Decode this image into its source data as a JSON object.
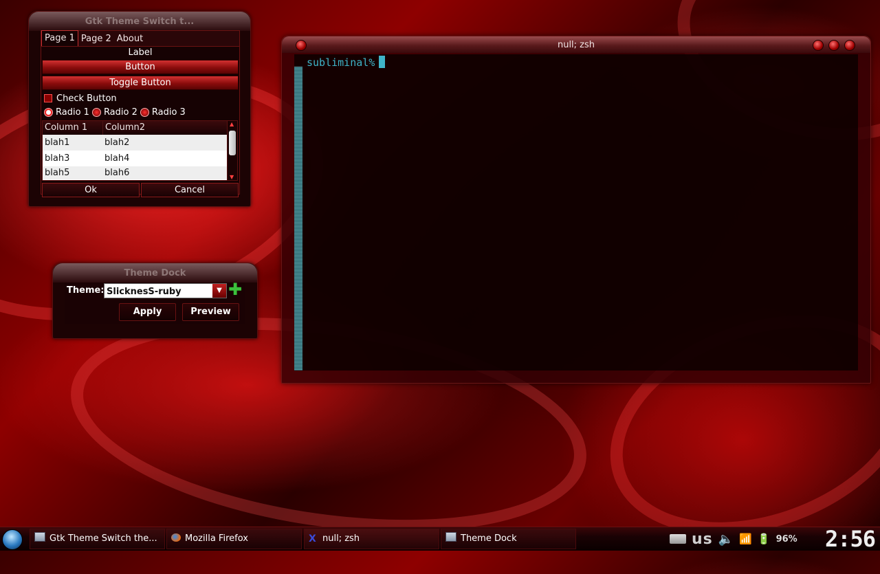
{
  "gtk_window": {
    "title": "Gtk Theme Switch t...",
    "tabs": [
      "Page 1",
      "Page 2",
      "About"
    ],
    "label": "Label",
    "button": "Button",
    "toggle_button": "Toggle Button",
    "check_button": "Check Button",
    "radios": [
      "Radio 1",
      "Radio 2",
      "Radio 3"
    ],
    "tree": {
      "columns": [
        "Column 1",
        "Column2"
      ],
      "rows": [
        [
          "blah1",
          "blah2"
        ],
        [
          "blah3",
          "blah4"
        ],
        [
          "blah5",
          "blah6"
        ]
      ]
    },
    "ok": "Ok",
    "cancel": "Cancel"
  },
  "theme_dock": {
    "title": "Theme Dock",
    "theme_label": "Theme:",
    "theme_value": "SlicknesS-ruby",
    "apply": "Apply",
    "preview": "Preview"
  },
  "terminal": {
    "title": "null; zsh",
    "prompt": "subliminal%"
  },
  "taskbar": {
    "tasks": [
      "Gtk Theme Switch the...",
      "Mozilla Firefox",
      "null; zsh",
      "Theme Dock"
    ],
    "keyboard_layout": "us",
    "battery": "96%",
    "clock": "2:56"
  },
  "colors": {
    "accent": "#c43030",
    "prompt": "#3fb4c8"
  }
}
